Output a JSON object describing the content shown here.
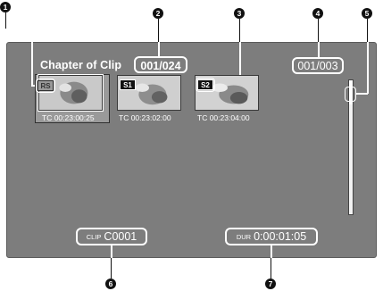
{
  "header": {
    "title": "Chapter of Clip",
    "clip_counter": "001/024",
    "chapter_counter": "001/003"
  },
  "thumbnails": [
    {
      "badge": "RS",
      "timecode": "TC 00:23:00:25",
      "selected": true
    },
    {
      "badge": "S1",
      "timecode": "TC 00:23:02:00",
      "selected": false
    },
    {
      "badge": "S2",
      "timecode": "TC 00:23:04:00",
      "selected": false
    }
  ],
  "footer": {
    "clip_label": "CLIP",
    "clip_value": "C0001",
    "dur_label": "DUR",
    "dur_value": "0:00:01:05"
  },
  "callouts": [
    "1",
    "2",
    "3",
    "4",
    "5",
    "6",
    "7"
  ],
  "colors": {
    "screen_bg": "#7d7d7d",
    "text": "#ffffff",
    "callout": "#111111"
  }
}
